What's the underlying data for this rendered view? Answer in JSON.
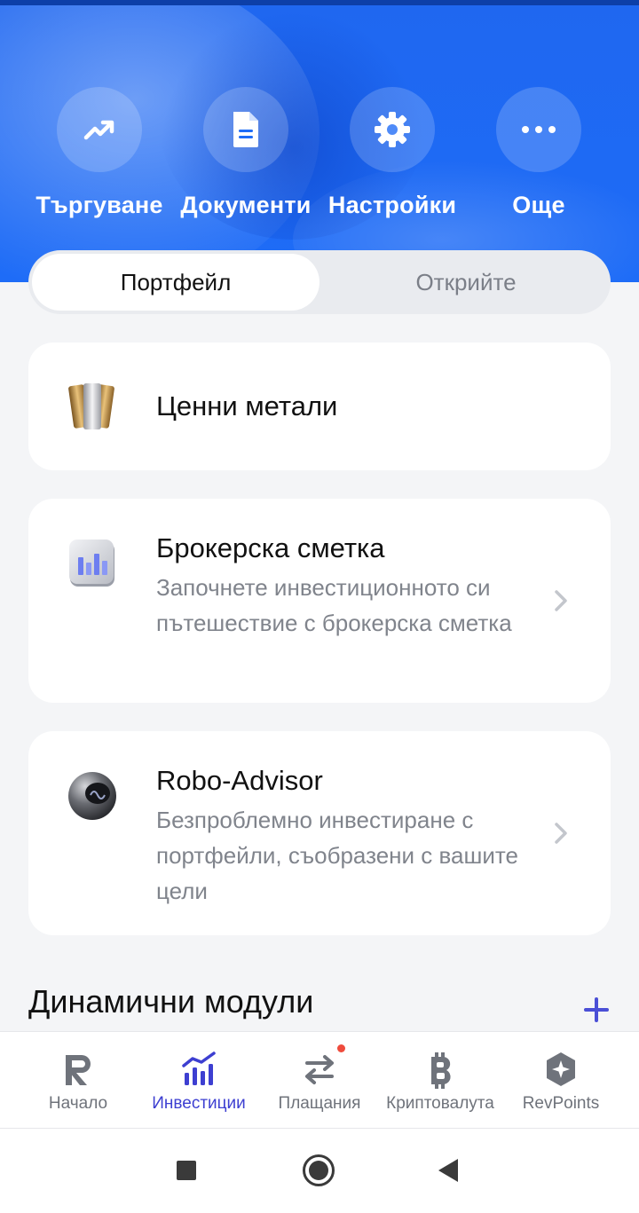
{
  "colors": {
    "hero_blue": "#1e6cf7",
    "accent": "#3d3fd1",
    "text": "#111111",
    "muted": "#80848c"
  },
  "actions": [
    {
      "label": "Търгуване",
      "icon": "trending-up-icon"
    },
    {
      "label": "Документи",
      "icon": "document-icon"
    },
    {
      "label": "Настройки",
      "icon": "gear-icon"
    },
    {
      "label": "Още",
      "icon": "more-dots-icon"
    }
  ],
  "segments": {
    "active": "Портфейл",
    "inactive": "Открийте"
  },
  "cards": [
    {
      "title": "Ценни метали",
      "icon": "precious-metals-icon"
    },
    {
      "title": "Брокерска сметка",
      "description": "Започнете инвестиционното си пътешествие с брокерска сметка",
      "icon": "brokerage-icon"
    },
    {
      "title": "Robo-Advisor",
      "description": "Безпроблемно инвестиране с портфейли, съобразени с вашите цели",
      "icon": "robo-advisor-icon"
    }
  ],
  "section": {
    "title": "Динамични модули"
  },
  "tabs": [
    {
      "label": "Начало",
      "icon": "revolut-r-icon",
      "active": false
    },
    {
      "label": "Инвестиции",
      "icon": "chart-bars-icon",
      "active": true
    },
    {
      "label": "Плащания",
      "icon": "transfer-arrows-icon",
      "active": false,
      "badge": true
    },
    {
      "label": "Криптовалута",
      "icon": "bitcoin-icon",
      "active": false
    },
    {
      "label": "RevPoints",
      "icon": "revpoints-icon",
      "active": false
    }
  ],
  "system_nav": [
    "recents-square-icon",
    "home-circle-icon",
    "back-triangle-icon"
  ]
}
